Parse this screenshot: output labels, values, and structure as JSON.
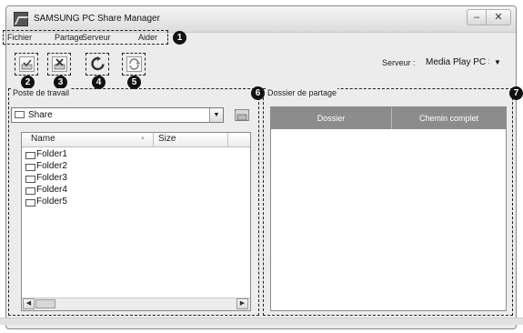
{
  "window": {
    "title": "SAMSUNG PC Share Manager",
    "minimize_label": "–",
    "close_label": "✕"
  },
  "menu": {
    "items": [
      {
        "label": "Fichier"
      },
      {
        "label": "Partage"
      },
      {
        "label": "Serveur"
      },
      {
        "label": "Aider"
      }
    ]
  },
  "toolbar": {
    "buttons": [
      {
        "icon": "share-folder-icon"
      },
      {
        "icon": "unshare-folder-icon"
      },
      {
        "icon": "refresh-icon"
      },
      {
        "icon": "apply-changes-icon"
      }
    ],
    "server_label": "Serveur :",
    "server_value": "Media Play PC Se"
  },
  "callouts": [
    "1",
    "2",
    "3",
    "4",
    "5",
    "6",
    "7"
  ],
  "left_panel": {
    "title": "Poste de travail",
    "combo_value": "Share",
    "columns": [
      "Name",
      "Size"
    ],
    "rows": [
      "Folder1",
      "Folder2",
      "Folder3",
      "Folder4",
      "Folder5"
    ]
  },
  "right_panel": {
    "title": "Dossier de partage",
    "columns": [
      "Dossier",
      "Chemin complet"
    ]
  }
}
